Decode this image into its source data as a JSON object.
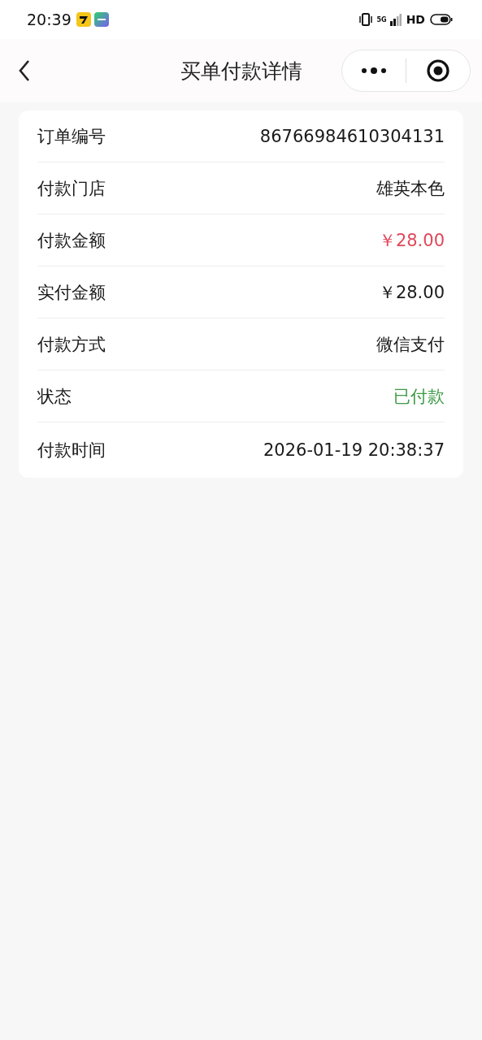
{
  "status_bar": {
    "time": "20:39",
    "network": "5G",
    "hd": "HD"
  },
  "nav": {
    "title": "买单付款详情"
  },
  "details": [
    {
      "label": "订单编号",
      "value": "86766984610304131",
      "color": "#1a1a1a"
    },
    {
      "label": "付款门店",
      "value": "雄英本色",
      "color": "#1a1a1a"
    },
    {
      "label": "付款金额",
      "value": "￥28.00",
      "color": "#e0485a"
    },
    {
      "label": "实付金额",
      "value": "￥28.00",
      "color": "#1a1a1a"
    },
    {
      "label": "付款方式",
      "value": "微信支付",
      "color": "#1a1a1a"
    },
    {
      "label": "状态",
      "value": "已付款",
      "color": "#3d9a45"
    },
    {
      "label": "付款时间",
      "value": "2026-01-19 20:38:37",
      "color": "#1a1a1a"
    }
  ]
}
